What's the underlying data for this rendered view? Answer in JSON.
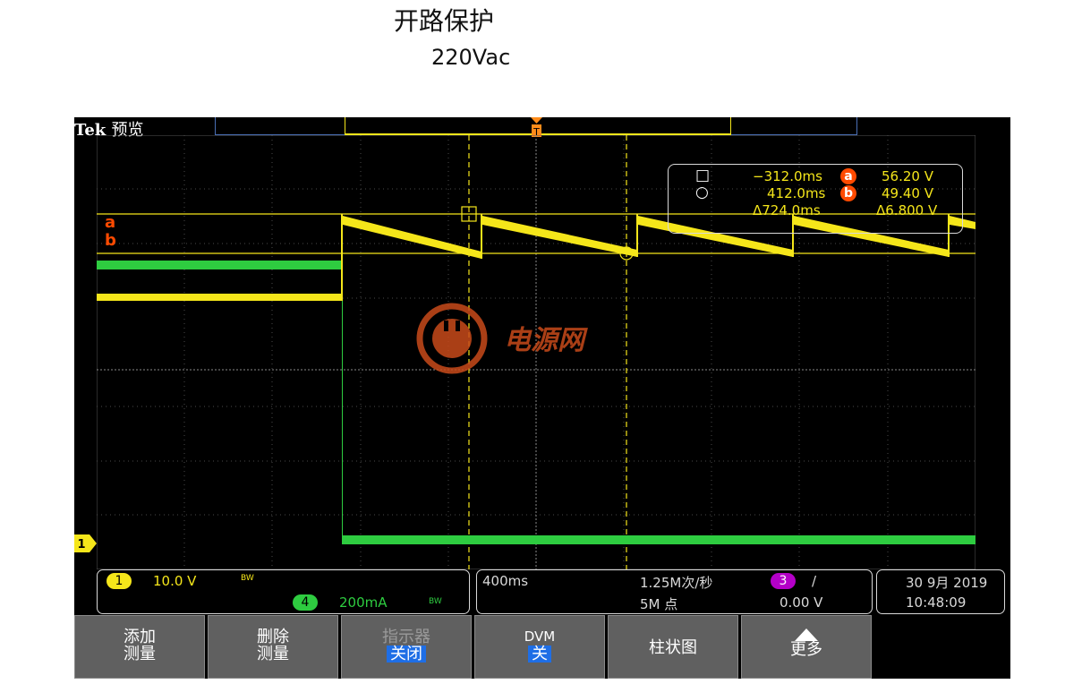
{
  "heading": {
    "title": "开路保护",
    "subtitle": "220Vac"
  },
  "scope": {
    "brand": "Tek",
    "mode": "预览",
    "measurements": {
      "cursor1_time": "−312.0ms",
      "cursor2_time": "412.0ms",
      "delta_time": "Δ724.0ms",
      "cursor_a_volt": "56.20 V",
      "cursor_b_volt": "49.40 V",
      "delta_volt": "Δ6.800 V",
      "label_a": "a",
      "label_b": "b"
    },
    "channels": {
      "ch1": {
        "num": "1",
        "scale": "10.0 V",
        "bw": "BW",
        "color": "#f5e61a"
      },
      "ch4": {
        "num": "4",
        "scale": "200mA",
        "bw": "BW",
        "color": "#2ecc40"
      },
      "ch3": {
        "num": "3",
        "trigger_level": "0.00 V",
        "color": "#b400c8"
      }
    },
    "timebase": "400ms",
    "sample_rate": "1.25M次/秒",
    "record_length": "5M 点",
    "trigger_slope": "/",
    "date": "30 9月 2019",
    "time": "10:48:09",
    "ground_marker": "1"
  },
  "softkeys": [
    {
      "line1": "添加",
      "line2": "测量",
      "enabled": true
    },
    {
      "line1": "删除",
      "line2": "测量",
      "enabled": true
    },
    {
      "line1": "指示器",
      "line2": "关闭",
      "enabled": false
    },
    {
      "line1": "DVM",
      "line2": "关",
      "enabled": true
    },
    {
      "line1": "柱状图",
      "line2": "",
      "enabled": true
    },
    {
      "line1": "更多",
      "line2": "",
      "enabled": true
    }
  ],
  "watermark": "电源网",
  "colors": {
    "screen_bg": "#000000",
    "grid": "#6b6b6b",
    "cursor": "#f5e61a",
    "softkey_bg": "#606060"
  }
}
